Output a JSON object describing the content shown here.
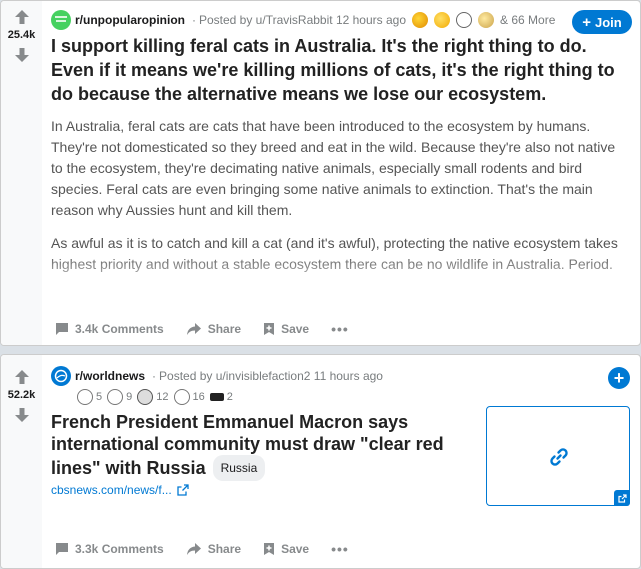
{
  "post1": {
    "score": "25.4k",
    "subreddit": "r/unpopularopinion",
    "posted_by": "Posted by u/TravisRabbit",
    "time": "12 hours ago",
    "more_awards": "& 66 More",
    "join_label": "Join",
    "join_plus": "+",
    "title": "I support killing feral cats in Australia. It's the right thing to do. Even if it means we're killing millions of cats, it's the right thing to do because the alternative means we lose our ecosystem.",
    "paragraphs": [
      "In Australia, feral cats are cats that have been introduced to the ecosystem by humans. They're not domesticated so they breed and eat in the wild. Because they're also not native to the ecosystem, they're decimating native animals, especially small rodents and bird species. Feral cats are even bringing some native animals to extinction. That's the main reason why Aussies hunt and kill them.",
      "As awful as it is to catch and kill a cat (and it's awful), protecting the native ecosystem takes highest priority and without a stable ecosystem there can be no wildlife in Australia. Period."
    ],
    "comments": "3.4k Comments",
    "share": "Share",
    "save": "Save",
    "more": "•••"
  },
  "post2": {
    "score": "52.2k",
    "subreddit": "r/worldnews",
    "posted_by": "Posted by u/invisiblefaction2",
    "time": "11 hours ago",
    "award_counts": [
      "5",
      "9",
      "12",
      "16",
      "2"
    ],
    "title": "French President Emmanuel Macron says international community must draw \"clear red lines\" with Russia",
    "flair": "Russia",
    "link": "cbsnews.com/news/f...",
    "comments": "3.3k Comments",
    "share": "Share",
    "save": "Save",
    "more": "•••"
  },
  "colors": {
    "accent": "#0079d3",
    "upvote": "#878a8c",
    "subreddit_icon_green": "#46d160"
  },
  "icons": [
    "upvote-icon",
    "downvote-icon",
    "comment-icon",
    "share-icon",
    "save-icon",
    "link-icon",
    "external-link-icon",
    "plus-icon"
  ]
}
